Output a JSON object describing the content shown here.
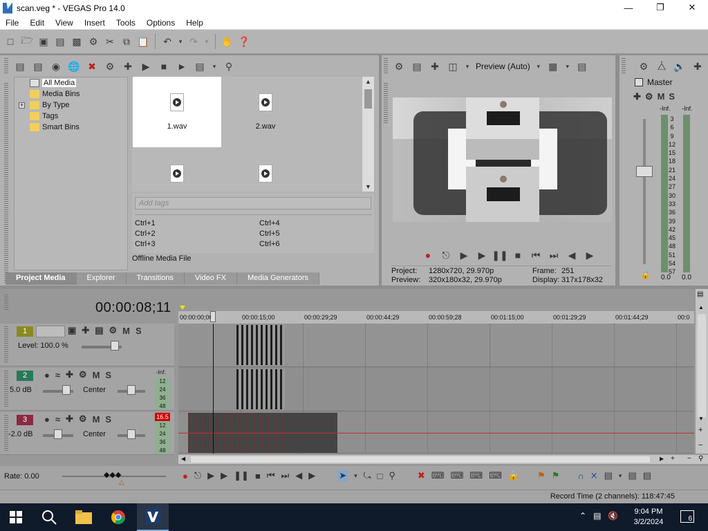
{
  "window": {
    "title": "scan.veg * - VEGAS Pro 14.0"
  },
  "menu": [
    "File",
    "Edit",
    "View",
    "Insert",
    "Tools",
    "Options",
    "Help"
  ],
  "project_media": {
    "tree": [
      {
        "label": "All Media",
        "selected": true
      },
      {
        "label": "Media Bins"
      },
      {
        "label": "By Type",
        "expandable": true
      },
      {
        "label": "Tags"
      },
      {
        "label": "Smart Bins"
      }
    ],
    "media_items": [
      "1.wav",
      "2.wav"
    ],
    "tags_placeholder": "Add tags",
    "shortcuts": [
      "Ctrl+1",
      "Ctrl+4",
      "Ctrl+2",
      "Ctrl+5",
      "Ctrl+3",
      "Ctrl+6"
    ],
    "status": "Offline Media File"
  },
  "tabs": [
    "Project Media",
    "Explorer",
    "Transitions",
    "Video FX",
    "Media Generators"
  ],
  "preview": {
    "quality": "Preview (Auto)",
    "project_label": "Project:",
    "project_value": "1280x720, 29.970p",
    "preview_label": "Preview:",
    "preview_value": "320x180x32, 29.970p",
    "frame_label": "Frame:",
    "frame_value": "251",
    "display_label": "Display:",
    "display_value": "317x178x32"
  },
  "master": {
    "title": "Master",
    "inf_left": "-Inf.",
    "inf_right": "-Inf.",
    "scale": [
      "3",
      "6",
      "9",
      "12",
      "15",
      "18",
      "21",
      "24",
      "27",
      "30",
      "33",
      "36",
      "39",
      "42",
      "45",
      "48",
      "51",
      "54",
      "57"
    ],
    "foot_left": "0.0",
    "foot_right": "0.0"
  },
  "timeline": {
    "timecode": "00:00:08;11",
    "ruler": [
      "00:00:00;00",
      "00:00:15;00",
      "00:00:29;29",
      "00:00:44;29",
      "00:00:59;28",
      "00:01:15;00",
      "00:01:29;29",
      "00:01:44;29",
      "00:0"
    ],
    "tracks": [
      {
        "num": "1",
        "label": "Level: 100.0 %",
        "color": "#8a8a20"
      },
      {
        "num": "2",
        "label": "5.0 dB",
        "pan": "Center",
        "meter_top": "-Inf.",
        "color": "#2a7a5a"
      },
      {
        "num": "3",
        "label": "-2.0 dB",
        "pan": "Center",
        "peak": "16.5",
        "color": "#8a2a40"
      }
    ],
    "mini_meter": [
      "12",
      "24",
      "36",
      "48"
    ]
  },
  "rate": "Rate: 0.00",
  "status_bar": "Record Time (2 channels): 118:47:45",
  "taskbar": {
    "time": "9:04 PM",
    "date": "3/2/2024",
    "notifications": "6"
  }
}
